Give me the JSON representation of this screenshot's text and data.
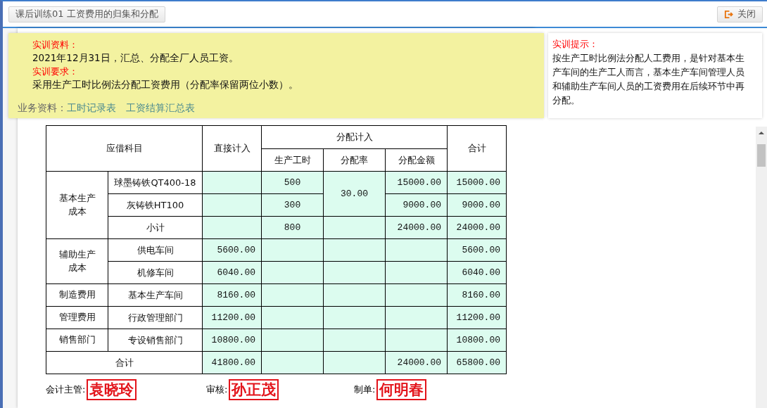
{
  "window": {
    "title": "课后训练01 工资费用的归集和分配",
    "close_label": "关闭"
  },
  "brief": {
    "sections": [
      {
        "heading": "实训资料：",
        "text": "2021年12月31日，汇总、分配全厂人员工资。"
      },
      {
        "heading": "实训要求：",
        "text": "采用生产工时比例法分配工资费用（分配率保留两位小数）。"
      }
    ],
    "links_label": "业务资料：",
    "links": [
      "工时记录表",
      "工资结算汇总表"
    ]
  },
  "hint": {
    "heading": "实训提示：",
    "text": "按生产工时比例法分配人工费用，是针对基本生产车间的生产工人而言，基本生产车间管理人员和辅助生产车间人员的工资费用在后续环节中再分配。"
  },
  "table": {
    "header": {
      "account": "应借科目",
      "direct": "直接计入",
      "allocated": "分配计入",
      "hours": "生产工时",
      "rate": "分配率",
      "amount": "分配金额",
      "total": "合计"
    },
    "groups": [
      {
        "category": "基本生产成本",
        "rate": "30.00",
        "rows": [
          {
            "item": "球墨铸铁QT400-18",
            "hours": "500",
            "amount": "15000.00",
            "total": "15000.00"
          },
          {
            "item": "灰铸铁HT100",
            "hours": "300",
            "amount": "9000.00",
            "total": "9000.00"
          }
        ],
        "subtotal": {
          "item": "小计",
          "hours": "800",
          "amount": "24000.00",
          "total": "24000.00"
        }
      },
      {
        "category": "辅助生产成本",
        "rows": [
          {
            "item": "供电车间",
            "direct": "5600.00",
            "total": "5600.00"
          },
          {
            "item": "机修车间",
            "direct": "6040.00",
            "total": "6040.00"
          }
        ]
      },
      {
        "category": "制造费用",
        "rows": [
          {
            "item": "基本生产车间",
            "direct": "8160.00",
            "total": "8160.00"
          }
        ]
      },
      {
        "category": "管理费用",
        "rows": [
          {
            "item": "行政管理部门",
            "direct": "11200.00",
            "total": "11200.00"
          }
        ]
      },
      {
        "category": "销售部门",
        "rows": [
          {
            "item": "专设销售部门",
            "direct": "10800.00",
            "total": "10800.00"
          }
        ]
      }
    ],
    "footer": {
      "label": "合计",
      "direct": "41800.00",
      "amount": "24000.00",
      "total": "65800.00"
    }
  },
  "signatures": [
    {
      "label": "会计主管:",
      "name": "袁晓玲"
    },
    {
      "label": "审核:",
      "name": "孙正茂"
    },
    {
      "label": "制单:",
      "name": "何明春"
    }
  ]
}
